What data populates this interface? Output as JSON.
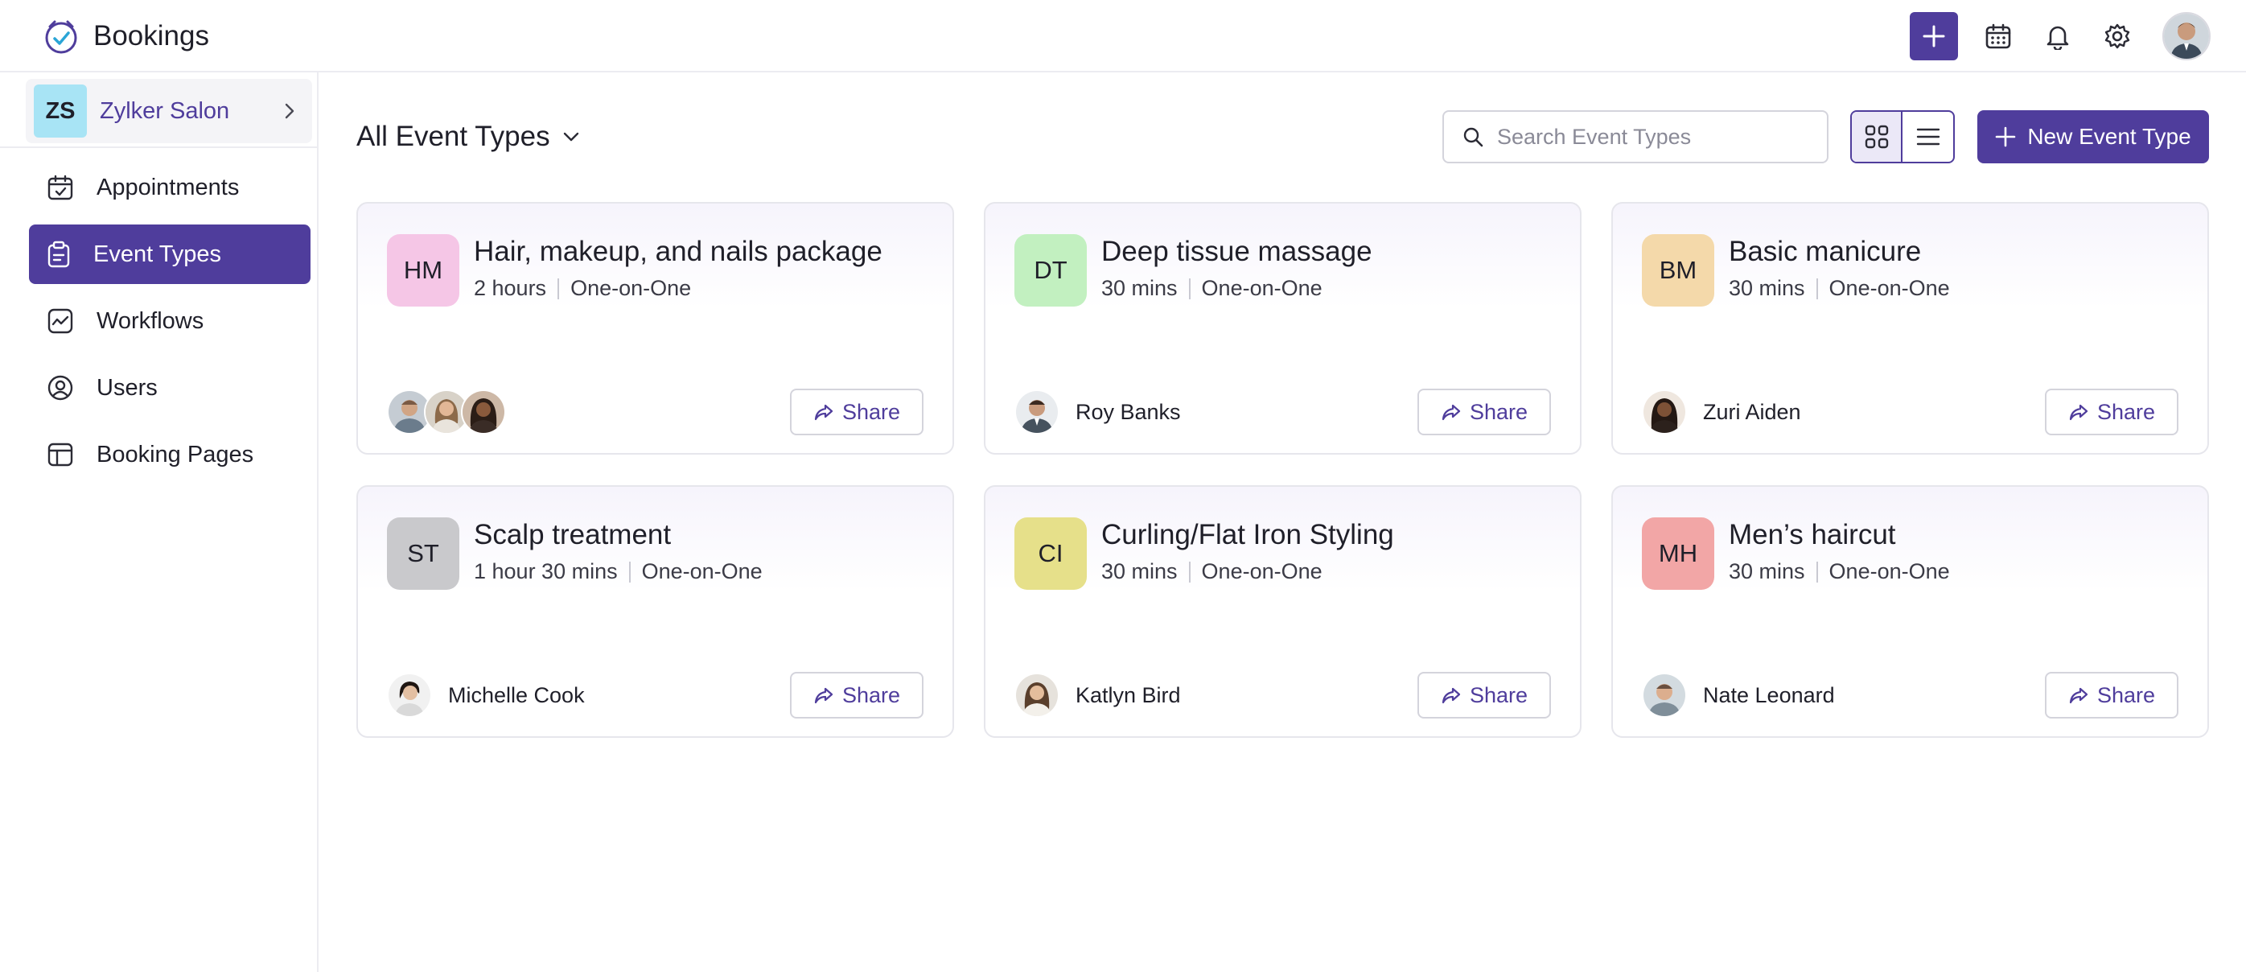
{
  "app": {
    "name": "Bookings",
    "logo_icon": "bookings-logo-icon"
  },
  "topbar": {
    "icons": [
      "add-icon",
      "calendar-icon",
      "bell-icon",
      "gear-icon",
      "user-avatar"
    ],
    "accent": "#4f3d9c"
  },
  "sidebar": {
    "org": {
      "initials": "ZS",
      "name": "Zylker Salon",
      "badge_color": "#a8e4f5"
    },
    "items": [
      {
        "label": "Appointments",
        "icon": "calendar-check-icon",
        "active": false
      },
      {
        "label": "Event Types",
        "icon": "clipboard-icon",
        "active": true
      },
      {
        "label": "Workflows",
        "icon": "workflow-icon",
        "active": false
      },
      {
        "label": "Users",
        "icon": "user-circle-icon",
        "active": false
      },
      {
        "label": "Booking Pages",
        "icon": "booking-page-icon",
        "active": false
      }
    ]
  },
  "header": {
    "title": "All Event Types",
    "search_placeholder": "Search Event Types",
    "view_mode": "grid",
    "new_button": "New Event Type"
  },
  "event_types": [
    {
      "initials": "HM",
      "title": "Hair, makeup, and nails package",
      "duration": "2 hours",
      "type": "One-on-One",
      "badge_color": "#f5c6e6",
      "people": [],
      "share": "Share"
    },
    {
      "initials": "DT",
      "title": "Deep tissue massage",
      "duration": "30 mins",
      "type": "One-on-One",
      "badge_color": "#c2f0c0",
      "people": [
        "Roy Banks"
      ],
      "share": "Share"
    },
    {
      "initials": "BM",
      "title": "Basic manicure",
      "duration": "30 mins",
      "type": "One-on-One",
      "badge_color": "#f4d9aa",
      "people": [
        "Zuri Aiden"
      ],
      "share": "Share"
    },
    {
      "initials": "ST",
      "title": "Scalp treatment",
      "duration": "1 hour 30 mins",
      "type": "One-on-One",
      "badge_color": "#c9c9cc",
      "people": [
        "Michelle Cook"
      ],
      "share": "Share"
    },
    {
      "initials": "CI",
      "title": "Curling/Flat Iron Styling",
      "duration": "30 mins",
      "type": "One-on-One",
      "badge_color": "#e6e08a",
      "people": [
        "Katlyn Bird"
      ],
      "share": "Share"
    },
    {
      "initials": "MH",
      "title": "Men’s haircut",
      "duration": "30 mins",
      "type": "One-on-One",
      "badge_color": "#f2a6a6",
      "people": [
        "Nate Leonard"
      ],
      "share": "Share"
    }
  ]
}
